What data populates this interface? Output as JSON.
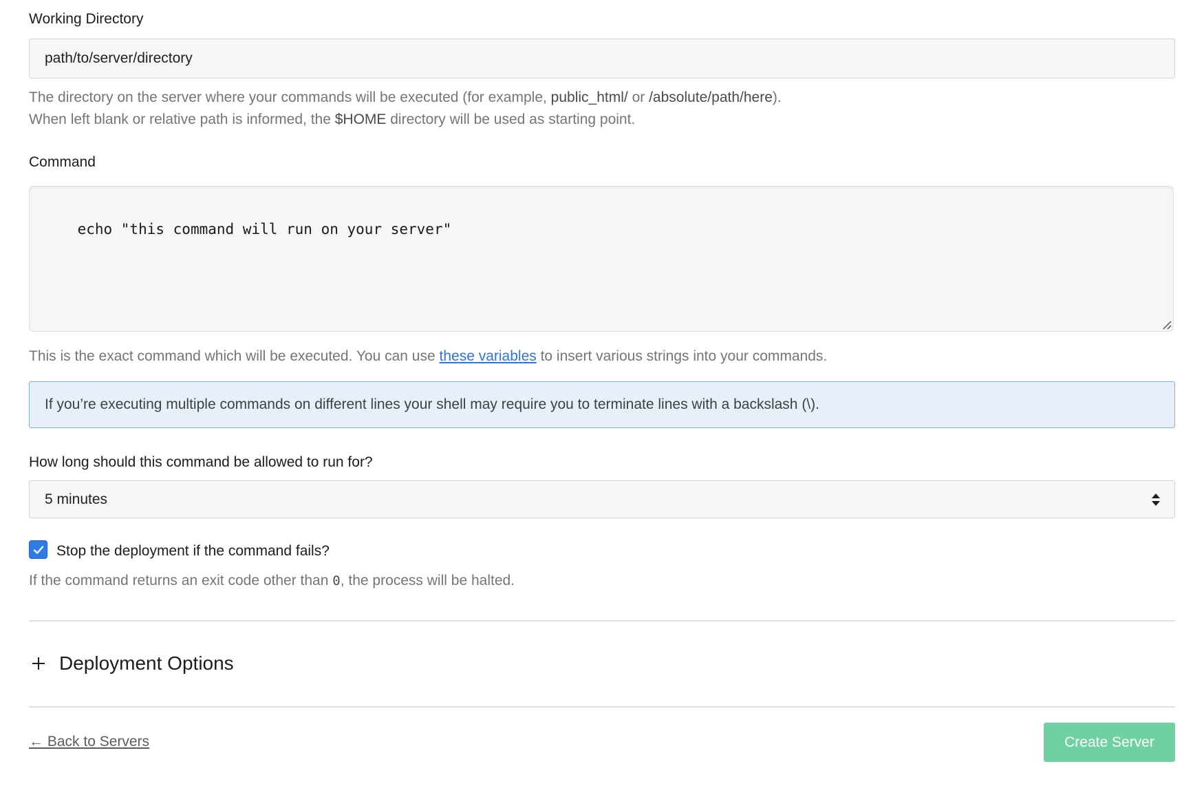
{
  "working_directory": {
    "label": "Working Directory",
    "value": "path/to/server/directory",
    "help_line1_prefix": "The directory on the server where your commands will be executed (for example, ",
    "help_example_1": "public_html/",
    "help_or": " or ",
    "help_example_2": "/absolute/path/here",
    "help_line1_suffix": ").",
    "help_line2_prefix": "When left blank or relative path is informed, the ",
    "help_home": "$HOME",
    "help_line2_suffix": " directory will be used as starting point."
  },
  "command": {
    "label": "Command",
    "value": "echo \"this command will run on your server\"",
    "help_prefix": "This is the exact command which will be executed. You can use ",
    "help_link": "these variables",
    "help_suffix": " to insert various strings into your commands."
  },
  "alert": {
    "text": "If you’re executing multiple commands on different lines your shell may require you to terminate lines with a backslash (\\)."
  },
  "timeout": {
    "label": "How long should this command be allowed to run for?",
    "selected": "5 minutes"
  },
  "stop_on_fail": {
    "checked": true,
    "label": "Stop the deployment if the command fails?",
    "help_prefix": "If the command returns an exit code other than ",
    "help_code": "0",
    "help_suffix": ", the process will be halted."
  },
  "deployment_options": {
    "title": "Deployment Options",
    "icon": "plus-icon"
  },
  "footer": {
    "back_label": "← Back to Servers",
    "submit_label": "Create Server"
  },
  "colors": {
    "accent_blue": "#2f7ae5",
    "link_blue": "#2f74d8",
    "alert_bg": "#e8eff9",
    "alert_border": "#7aaee8",
    "button_green": "#6fd0a1",
    "input_bg": "#f6f6f6"
  }
}
